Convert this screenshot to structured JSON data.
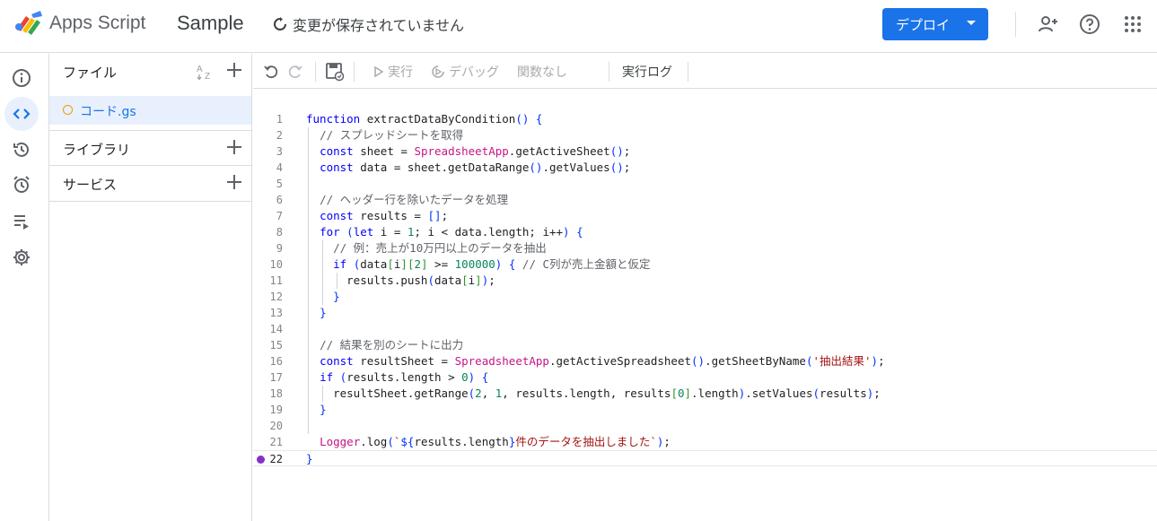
{
  "header": {
    "app_name": "Apps Script",
    "project_name": "Sample",
    "save_status": "変更が保存されていません",
    "deploy_label": "デプロイ"
  },
  "files_panel": {
    "files_title": "ファイル",
    "file_name": "コード.gs",
    "libraries_title": "ライブラリ",
    "services_title": "サービス"
  },
  "toolbar": {
    "run_label": "実行",
    "debug_label": "デバッグ",
    "function_label": "関数なし",
    "log_label": "実行ログ"
  },
  "editor": {
    "current_line": 22,
    "breakpoint_line": 22,
    "lines": [
      "function extractDataByCondition() {",
      "  // スプレッドシートを取得",
      "  const sheet = SpreadsheetApp.getActiveSheet();",
      "  const data = sheet.getDataRange().getValues();",
      "",
      "  // ヘッダー行を除いたデータを処理",
      "  const results = [];",
      "  for (let i = 1; i < data.length; i++) {",
      "    // 例：売上が10万円以上のデータを抽出",
      "    if (data[i][2] >= 100000) { // C列が売上金額と仮定",
      "      results.push(data[i]);",
      "    }",
      "  }",
      "",
      "  // 結果を別のシートに出力",
      "  const resultSheet = SpreadsheetApp.getActiveSpreadsheet().getSheetByName('抽出結果');",
      "  if (results.length > 0) {",
      "    resultSheet.getRange(2, 1, results.length, results[0].length).setValues(results);",
      "  }",
      "",
      "  Logger.log(`${results.length}件のデータを抽出しました`);",
      "}"
    ]
  },
  "colors": {
    "accent": "#1a73e8",
    "keyword": "#0000ff",
    "comment": "#5f6368",
    "class": "#c71585",
    "string": "#a31515",
    "number": "#098658",
    "breakpoint": "#8430ce"
  }
}
